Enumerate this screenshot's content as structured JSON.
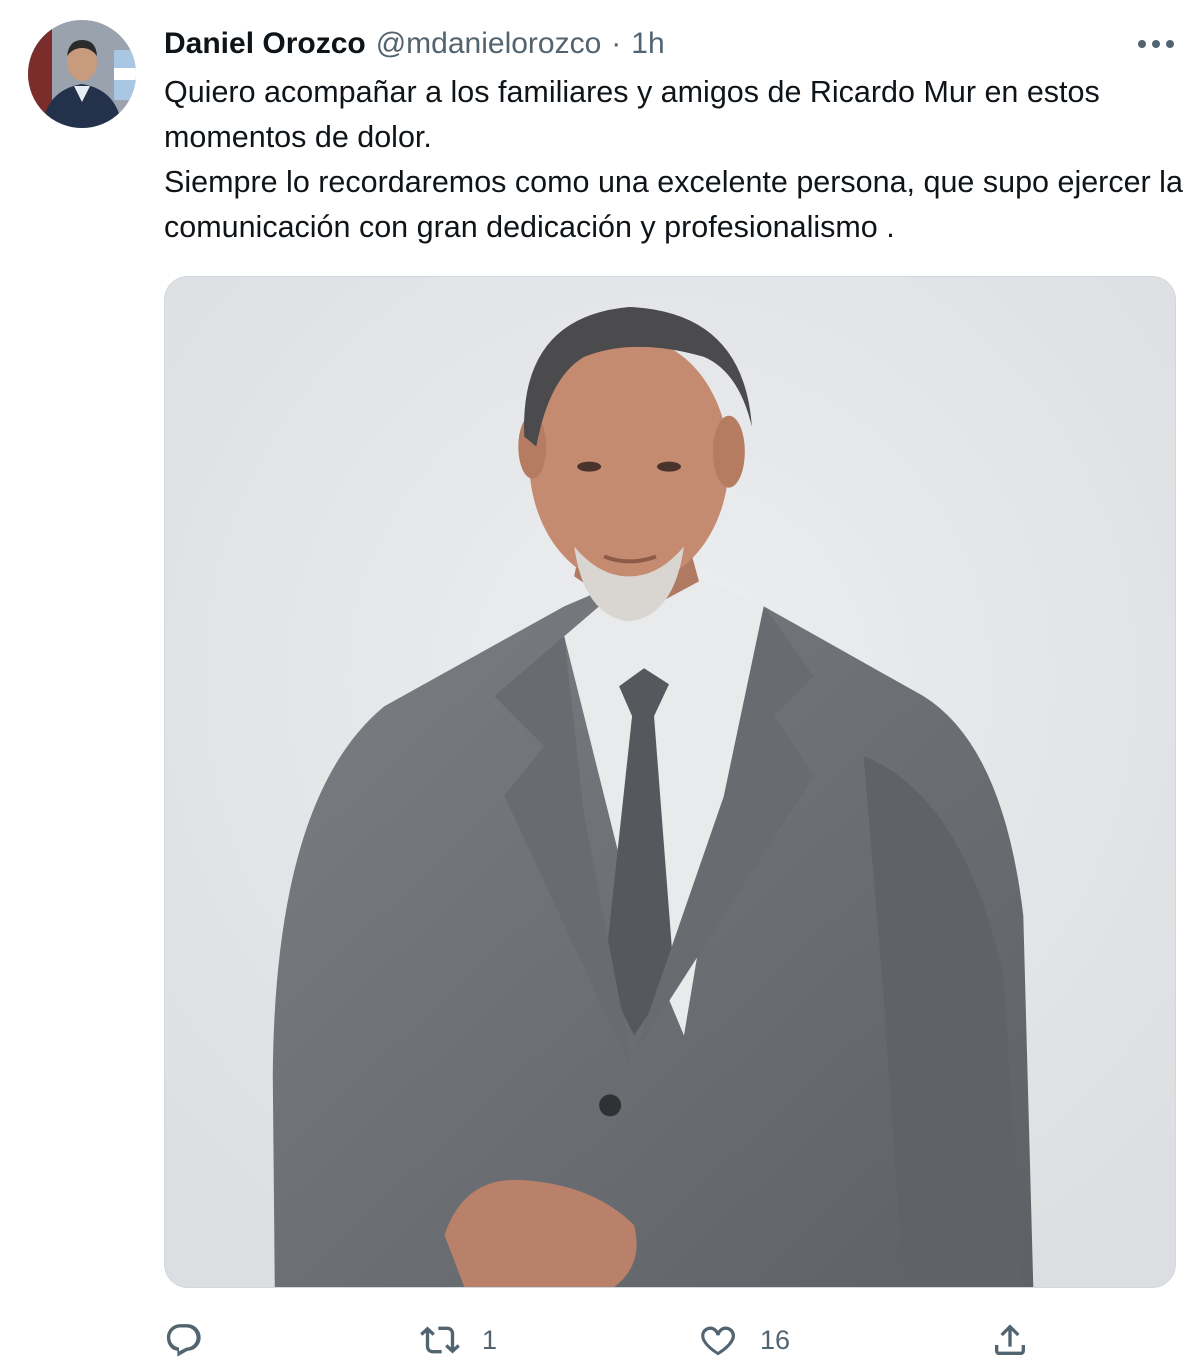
{
  "tweet": {
    "author_name": "Daniel Orozco",
    "author_handle": "@mdanielorozco",
    "separator": "·",
    "time": "1h",
    "text": "Quiero acompañar a los familiares y amigos de Ricardo Mur en estos momentos de dolor.\nSiempre lo recordaremos como una excelente persona, que supo ejercer la comunicación con gran dedicación y profesionalismo ."
  },
  "actions": {
    "reply_icon": "reply-icon",
    "reply_count": "",
    "retweet_icon": "retweet-icon",
    "retweet_count": "1",
    "like_icon": "heart-icon",
    "like_count": "16",
    "share_icon": "share-icon"
  },
  "colors": {
    "text": "#0f1419",
    "secondary": "#536471",
    "border": "#cfd9de",
    "photo_background": "#e3e4e6",
    "suit": "#6d7074"
  }
}
